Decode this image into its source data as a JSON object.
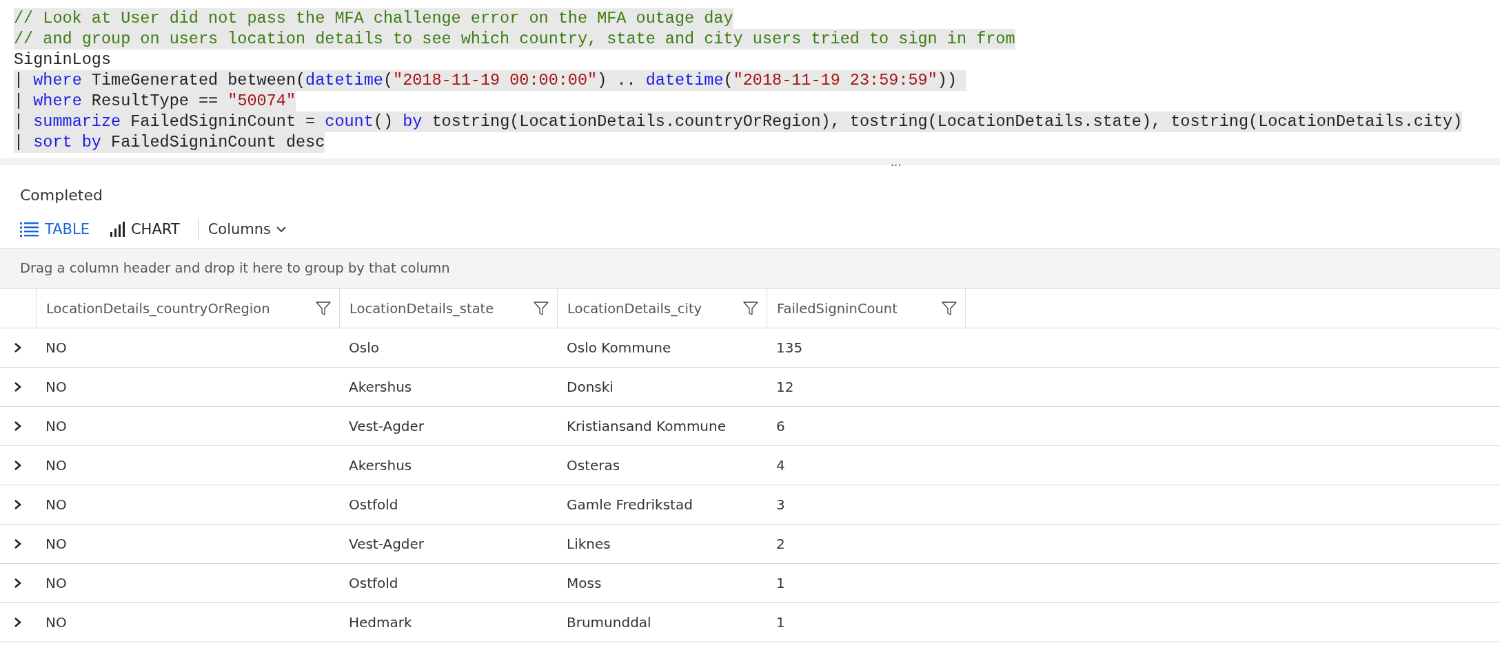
{
  "query_editor": {
    "lines": [
      {
        "highlighted": true,
        "tokens": [
          {
            "kind": "comment",
            "text": "// Look at User did not pass the MFA challenge error on the MFA outage day"
          }
        ]
      },
      {
        "highlighted": true,
        "tokens": [
          {
            "kind": "comment",
            "text": "// and group on users location details to see which country, state and city users tried to sign in from"
          }
        ]
      },
      {
        "highlighted": false,
        "tokens": [
          {
            "kind": "plain",
            "text": "SigninLogs"
          }
        ]
      },
      {
        "highlighted": true,
        "tokens": [
          {
            "kind": "plain",
            "text": "| "
          },
          {
            "kind": "keyword",
            "text": "where"
          },
          {
            "kind": "plain",
            "text": " TimeGenerated between("
          },
          {
            "kind": "keyword",
            "text": "datetime"
          },
          {
            "kind": "plain",
            "text": "("
          },
          {
            "kind": "string",
            "text": "\"2018-11-19 00:00:00\""
          },
          {
            "kind": "plain",
            "text": ") .. "
          },
          {
            "kind": "keyword",
            "text": "datetime"
          },
          {
            "kind": "plain",
            "text": "("
          },
          {
            "kind": "string",
            "text": "\"2018-11-19 23:59:59\""
          },
          {
            "kind": "plain",
            "text": ")) "
          }
        ]
      },
      {
        "highlighted": true,
        "tokens": [
          {
            "kind": "plain",
            "text": "| "
          },
          {
            "kind": "keyword",
            "text": "where"
          },
          {
            "kind": "plain",
            "text": " ResultType == "
          },
          {
            "kind": "string",
            "text": "\"50074\""
          }
        ]
      },
      {
        "highlighted": true,
        "tokens": [
          {
            "kind": "plain",
            "text": "| "
          },
          {
            "kind": "keyword",
            "text": "summarize"
          },
          {
            "kind": "plain",
            "text": " FailedSigninCount = "
          },
          {
            "kind": "keyword",
            "text": "count"
          },
          {
            "kind": "plain",
            "text": "() "
          },
          {
            "kind": "keyword",
            "text": "by"
          },
          {
            "kind": "plain",
            "text": " tostring(LocationDetails.countryOrRegion), tostring(LocationDetails.state), tostring(LocationDetails.city)"
          }
        ]
      },
      {
        "highlighted": true,
        "tokens": [
          {
            "kind": "plain",
            "text": "| "
          },
          {
            "kind": "keyword",
            "text": "sort by"
          },
          {
            "kind": "plain",
            "text": " FailedSigninCount desc"
          }
        ]
      }
    ]
  },
  "splitter": {
    "handle": "..."
  },
  "results": {
    "status": "Completed",
    "view_tabs": [
      {
        "kind": "table",
        "label": "TABLE",
        "selected": true
      },
      {
        "kind": "chart",
        "label": "CHART",
        "selected": false
      }
    ],
    "columns_menu": {
      "label": "Columns"
    },
    "group_hint": "Drag a column header and drop it here to group by that column",
    "table": {
      "columns": [
        "LocationDetails_countryOrRegion",
        "LocationDetails_state",
        "LocationDetails_city",
        "FailedSigninCount"
      ],
      "rows": [
        {
          "expanded": false,
          "cells": [
            "NO",
            "Oslo",
            "Oslo Kommune",
            "135"
          ]
        },
        {
          "expanded": false,
          "cells": [
            "NO",
            "Akershus",
            "Donski",
            "12"
          ]
        },
        {
          "expanded": false,
          "cells": [
            "NO",
            "Vest-Agder",
            "Kristiansand Kommune",
            "6"
          ]
        },
        {
          "expanded": false,
          "cells": [
            "NO",
            "Akershus",
            "Osteras",
            "4"
          ]
        },
        {
          "expanded": false,
          "cells": [
            "NO",
            "Ostfold",
            "Gamle Fredrikstad",
            "3"
          ]
        },
        {
          "expanded": false,
          "cells": [
            "NO",
            "Vest-Agder",
            "Liknes",
            "2"
          ]
        },
        {
          "expanded": false,
          "cells": [
            "NO",
            "Ostfold",
            "Moss",
            "1"
          ]
        },
        {
          "expanded": false,
          "cells": [
            "NO",
            "Hedmark",
            "Brumunddal",
            "1"
          ]
        }
      ]
    }
  }
}
